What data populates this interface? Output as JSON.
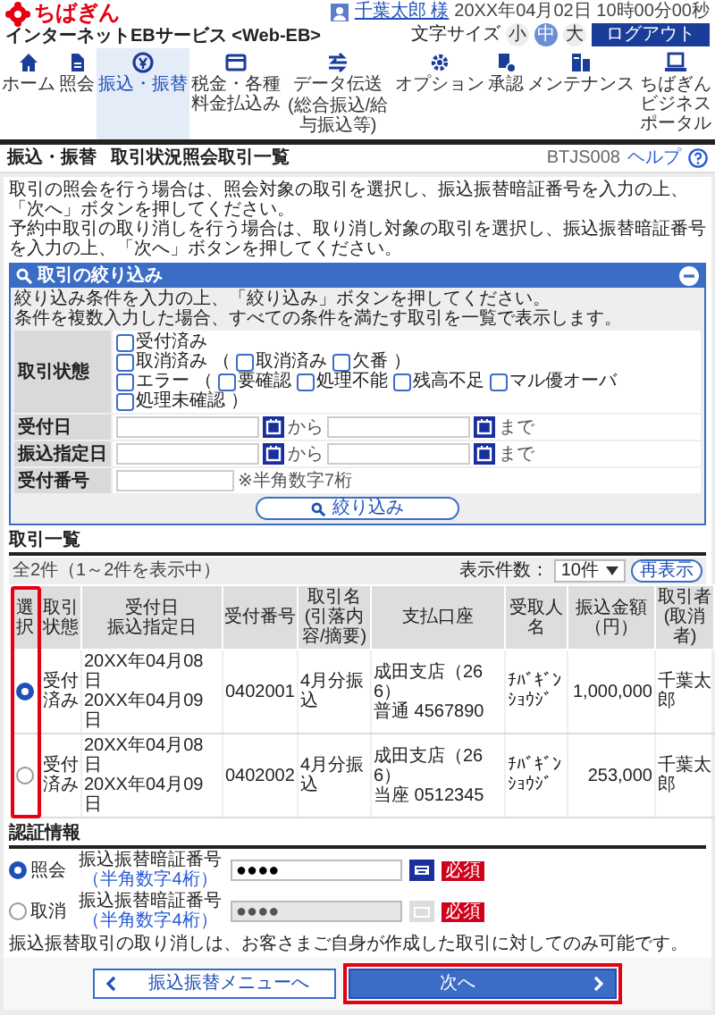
{
  "header": {
    "logo": "ちばぎん",
    "service": "インターネットEBサービス <Web-EB>",
    "user": "千葉太郎 様",
    "datetime": "20XX年04月02日 10時00分00秒",
    "font_size_label": "文字サイズ",
    "font_sizes": [
      {
        "label": "小",
        "selected": false
      },
      {
        "label": "中",
        "selected": true
      },
      {
        "label": "大",
        "selected": false
      }
    ],
    "logout": "ログアウト"
  },
  "nav": [
    {
      "label": "ホーム",
      "selected": false
    },
    {
      "label": "照会",
      "selected": false
    },
    {
      "label": "振込・振替",
      "selected": true
    },
    {
      "label": "税金・各種料金払込み",
      "selected": false
    },
    {
      "label": "データ伝送",
      "sublabel": "(総合振込/給与振込等)",
      "selected": false
    },
    {
      "label": "オプション",
      "selected": false
    },
    {
      "label": "承認",
      "selected": false
    },
    {
      "label": "メンテナンス",
      "selected": false
    },
    {
      "label": "ちばぎんビジネスポータル",
      "selected": false
    }
  ],
  "page": {
    "section": "振込・振替",
    "title": "取引状況照会取引一覧",
    "code": "BTJS008",
    "help": "ヘルプ"
  },
  "intro": [
    "取引の照会を行う場合は、照会対象の取引を選択し、振込振替暗証番号を入力の上、「次へ」ボタンを押してください。",
    "予約中取引の取り消しを行う場合は、取り消し対象の取引を選択し、振込振替暗証番号を入力の上、「次へ」ボタンを押してください。"
  ],
  "filter": {
    "title": "取引の絞り込み",
    "expanded": true,
    "description": [
      "絞り込み条件を入力の上、「絞り込み」ボタンを押してください。",
      "条件を複数入力した場合、すべての条件を満たす取引を一覧で表示します。"
    ],
    "status": {
      "label": "取引状態",
      "rows": [
        {
          "main": {
            "label": "受付済み",
            "checked": false
          }
        },
        {
          "main": {
            "label": "取消済み",
            "checked": false
          },
          "open": "（",
          "subs": [
            {
              "label": "取消済み",
              "checked": false
            },
            {
              "label": "欠番",
              "checked": false
            }
          ],
          "close": "）"
        },
        {
          "main": {
            "label": "エラー",
            "checked": false
          },
          "open": "（",
          "subs": [
            {
              "label": "要確認",
              "checked": false
            },
            {
              "label": "処理不能",
              "checked": false
            },
            {
              "label": "残高不足",
              "checked": false
            },
            {
              "label": "マル優オーバ",
              "checked": false
            },
            {
              "label": "処理未確認",
              "checked": false
            }
          ],
          "close": "）"
        }
      ]
    },
    "date_ranges": [
      {
        "label": "受付日",
        "from": "から",
        "to": "まで"
      },
      {
        "label": "振込指定日",
        "from": "から",
        "to": "まで"
      }
    ],
    "number": {
      "label": "受付番号",
      "hint": "※半角数字7桁"
    },
    "button": "絞り込み"
  },
  "list": {
    "title": "取引一覧",
    "count": "全2件（1～2件を表示中）",
    "page_size_label": "表示件数：",
    "page_size": "10件",
    "refresh": "再表示",
    "columns": [
      {
        "label": "選択",
        "highlighted": true
      },
      {
        "label": "取引状態",
        "highlighted": false
      },
      {
        "label": "受付日",
        "sublabel": "振込指定日",
        "highlighted": false
      },
      {
        "label": "受付番号",
        "highlighted": false
      },
      {
        "label": "取引名",
        "sublabel": "(引落内容/摘要)",
        "highlighted": false
      },
      {
        "label": "支払口座",
        "highlighted": false
      },
      {
        "label": "受取人名",
        "highlighted": false
      },
      {
        "label": "振込金額（円）",
        "highlighted": false
      },
      {
        "label": "取引者",
        "sublabel": "(取消者)",
        "highlighted": false
      }
    ],
    "rows": [
      {
        "selected": true,
        "cells": [
          "",
          "受付済み",
          [
            "20XX年04月08日",
            "20XX年04月09日"
          ],
          "0402001",
          "4月分振込",
          [
            "成田支店（266）",
            "普通 4567890"
          ],
          "ﾁﾊﾞｷﾞﾝｼｮｳｼﾞ",
          "1,000,000",
          "千葉太郎"
        ]
      },
      {
        "selected": false,
        "cells": [
          "",
          "受付済み",
          [
            "20XX年04月08日",
            "20XX年04月09日"
          ],
          "0402002",
          "4月分振込",
          [
            "成田支店（266）",
            "当座 0512345"
          ],
          "ﾁﾊﾞｷﾞﾝｼｮｳｼﾞ",
          "253,000",
          "千葉太郎"
        ]
      }
    ]
  },
  "auth": {
    "title": "認証情報",
    "rows": [
      {
        "label": "照会",
        "selected": true,
        "field_label": "振込振替暗証番号",
        "field_hint": "（半角数字4桁）",
        "value": "●●●●",
        "disabled": false,
        "required": "必須"
      },
      {
        "label": "取消",
        "selected": false,
        "field_label": "振込振替暗証番号",
        "field_hint": "（半角数字4桁）",
        "value": "●●●●",
        "disabled": true,
        "required": "必須"
      }
    ],
    "note": "振込振替取引の取り消しは、お客さまご自身が作成した取引に対してのみ可能です。"
  },
  "buttons": {
    "back": {
      "label": "振込振替メニューへ"
    },
    "next": {
      "label": "次へ",
      "highlighted": true
    }
  }
}
